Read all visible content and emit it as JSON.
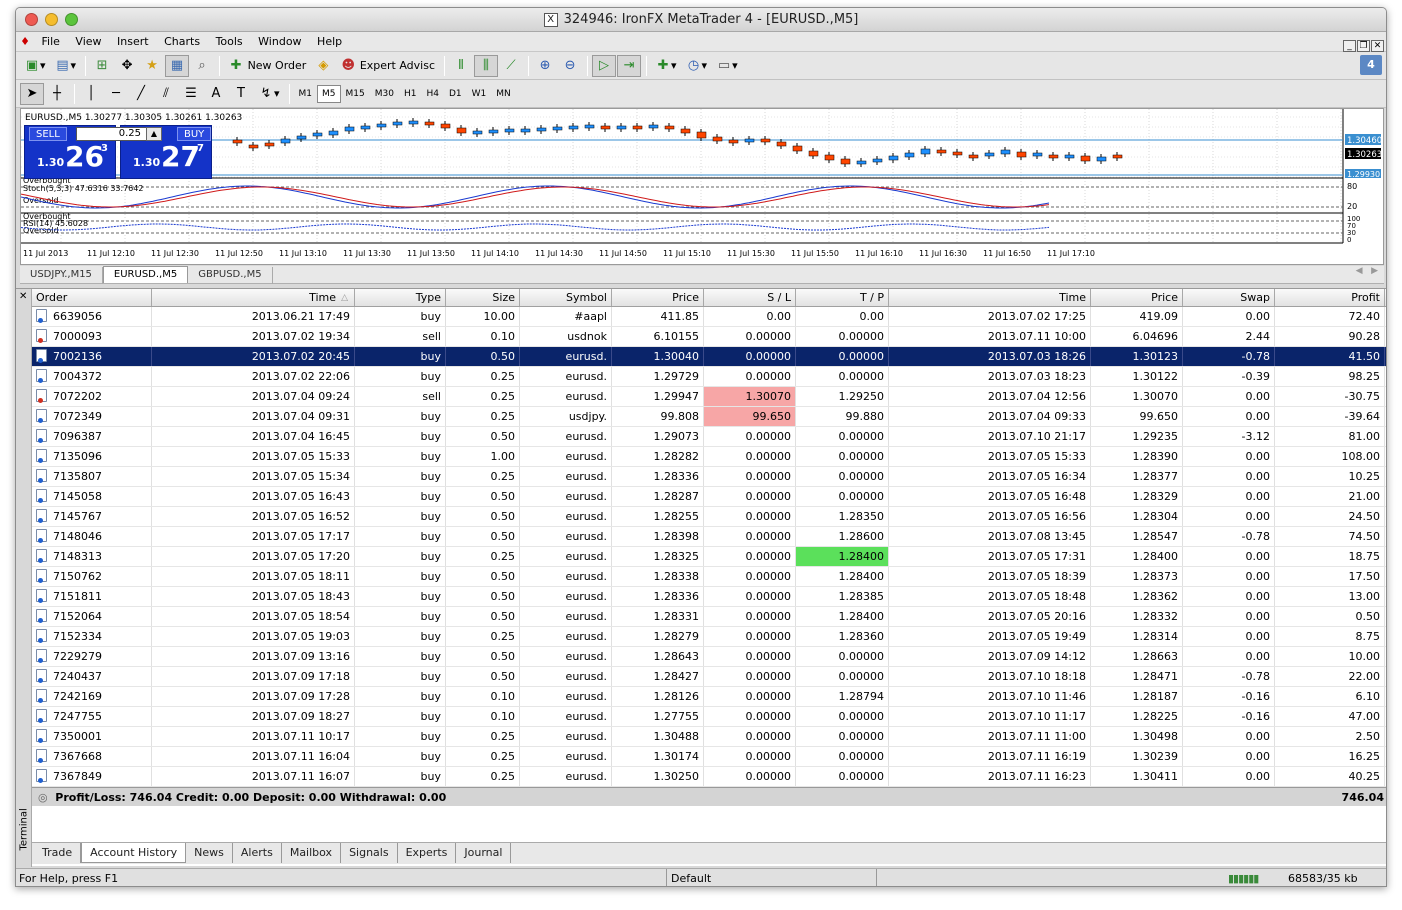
{
  "window": {
    "title": "324946: IronFX MetaTrader 4 - [EURUSD.,M5]"
  },
  "menu": [
    "File",
    "View",
    "Insert",
    "Charts",
    "Tools",
    "Window",
    "Help"
  ],
  "toolbar1": {
    "new_order": "New Order",
    "expert_advisors": "Expert Advisc",
    "badge": "4"
  },
  "timeframes": [
    "M1",
    "M5",
    "M15",
    "M30",
    "H1",
    "H4",
    "D1",
    "W1",
    "MN"
  ],
  "active_timeframe": "M5",
  "chart": {
    "header": "EURUSD.,M5  1.30277 1.30305 1.30261 1.30263",
    "one_click": {
      "sell_label": "SELL",
      "buy_label": "BUY",
      "volume": "0.25",
      "sell_small": "1.30",
      "sell_big": "26",
      "sell_sup": "3",
      "buy_small": "1.30",
      "buy_big": "27",
      "buy_sup": "7"
    },
    "price_labels": [
      "1.30460",
      "1.30263",
      "1.29930"
    ],
    "stoch": {
      "label": "Stoch(5,3,3) 47.6316 33.7642",
      "overbought": "Overbought",
      "oversold": "Oversold",
      "levels": [
        "80",
        "20"
      ]
    },
    "rsi": {
      "label": "RSI(14) 45.6028",
      "overbought": "Overbought",
      "oversold": "Oversold",
      "levels": [
        "100",
        "70",
        "30",
        "0"
      ]
    },
    "time_labels": [
      "11 Jul 2013",
      "11 Jul 12:10",
      "11 Jul 12:30",
      "11 Jul 12:50",
      "11 Jul 13:10",
      "11 Jul 13:30",
      "11 Jul 13:50",
      "11 Jul 14:10",
      "11 Jul 14:30",
      "11 Jul 14:50",
      "11 Jul 15:10",
      "11 Jul 15:30",
      "11 Jul 15:50",
      "11 Jul 16:10",
      "11 Jul 16:30",
      "11 Jul 16:50",
      "11 Jul 17:10"
    ]
  },
  "chart_tabs": [
    "USDJPY.,M15",
    "EURUSD.,M5",
    "GBPUSD.,M5"
  ],
  "active_chart_tab": "EURUSD.,M5",
  "colors": {
    "bull": "#1e90ff",
    "bear": "#ff4500",
    "selection": "#0a246a",
    "sl_hit": "#f7a6a6",
    "tp_hit": "#5be05b"
  },
  "table": {
    "columns": [
      "Order",
      "Time",
      "Type",
      "Size",
      "Symbol",
      "Price",
      "S / L",
      "T / P",
      "Time",
      "Price",
      "Swap",
      "Profit"
    ],
    "rows": [
      [
        "6639056",
        "2013.06.21 17:49",
        "buy",
        "10.00",
        "#aapl",
        "411.85",
        "0.00",
        "0.00",
        "2013.07.02 17:25",
        "419.09",
        "0.00",
        "72.40"
      ],
      [
        "7000093",
        "2013.07.02 19:34",
        "sell",
        "0.10",
        "usdnok",
        "6.10155",
        "0.00000",
        "0.00000",
        "2013.07.11 10:00",
        "6.04696",
        "2.44",
        "90.28"
      ],
      [
        "7002136",
        "2013.07.02 20:45",
        "buy",
        "0.50",
        "eurusd.",
        "1.30040",
        "0.00000",
        "0.00000",
        "2013.07.03 18:26",
        "1.30123",
        "-0.78",
        "41.50"
      ],
      [
        "7004372",
        "2013.07.02 22:06",
        "buy",
        "0.25",
        "eurusd.",
        "1.29729",
        "0.00000",
        "0.00000",
        "2013.07.03 18:23",
        "1.30122",
        "-0.39",
        "98.25"
      ],
      [
        "7072202",
        "2013.07.04 09:24",
        "sell",
        "0.25",
        "eurusd.",
        "1.29947",
        "1.30070",
        "1.29250",
        "2013.07.04 12:56",
        "1.30070",
        "0.00",
        "-30.75"
      ],
      [
        "7072349",
        "2013.07.04 09:31",
        "buy",
        "0.25",
        "usdjpy.",
        "99.808",
        "99.650",
        "99.880",
        "2013.07.04 09:33",
        "99.650",
        "0.00",
        "-39.64"
      ],
      [
        "7096387",
        "2013.07.04 16:45",
        "buy",
        "0.50",
        "eurusd.",
        "1.29073",
        "0.00000",
        "0.00000",
        "2013.07.10 21:17",
        "1.29235",
        "-3.12",
        "81.00"
      ],
      [
        "7135096",
        "2013.07.05 15:33",
        "buy",
        "1.00",
        "eurusd.",
        "1.28282",
        "0.00000",
        "0.00000",
        "2013.07.05 15:33",
        "1.28390",
        "0.00",
        "108.00"
      ],
      [
        "7135807",
        "2013.07.05 15:34",
        "buy",
        "0.25",
        "eurusd.",
        "1.28336",
        "0.00000",
        "0.00000",
        "2013.07.05 16:34",
        "1.28377",
        "0.00",
        "10.25"
      ],
      [
        "7145058",
        "2013.07.05 16:43",
        "buy",
        "0.50",
        "eurusd.",
        "1.28287",
        "0.00000",
        "0.00000",
        "2013.07.05 16:48",
        "1.28329",
        "0.00",
        "21.00"
      ],
      [
        "7145767",
        "2013.07.05 16:52",
        "buy",
        "0.50",
        "eurusd.",
        "1.28255",
        "0.00000",
        "1.28350",
        "2013.07.05 16:56",
        "1.28304",
        "0.00",
        "24.50"
      ],
      [
        "7148046",
        "2013.07.05 17:17",
        "buy",
        "0.50",
        "eurusd.",
        "1.28398",
        "0.00000",
        "1.28600",
        "2013.07.08 13:45",
        "1.28547",
        "-0.78",
        "74.50"
      ],
      [
        "7148313",
        "2013.07.05 17:20",
        "buy",
        "0.25",
        "eurusd.",
        "1.28325",
        "0.00000",
        "1.28400",
        "2013.07.05 17:31",
        "1.28400",
        "0.00",
        "18.75"
      ],
      [
        "7150762",
        "2013.07.05 18:11",
        "buy",
        "0.50",
        "eurusd.",
        "1.28338",
        "0.00000",
        "1.28400",
        "2013.07.05 18:39",
        "1.28373",
        "0.00",
        "17.50"
      ],
      [
        "7151811",
        "2013.07.05 18:43",
        "buy",
        "0.50",
        "eurusd.",
        "1.28336",
        "0.00000",
        "1.28385",
        "2013.07.05 18:48",
        "1.28362",
        "0.00",
        "13.00"
      ],
      [
        "7152064",
        "2013.07.05 18:54",
        "buy",
        "0.50",
        "eurusd.",
        "1.28331",
        "0.00000",
        "1.28400",
        "2013.07.05 20:16",
        "1.28332",
        "0.00",
        "0.50"
      ],
      [
        "7152334",
        "2013.07.05 19:03",
        "buy",
        "0.25",
        "eurusd.",
        "1.28279",
        "0.00000",
        "1.28360",
        "2013.07.05 19:49",
        "1.28314",
        "0.00",
        "8.75"
      ],
      [
        "7229279",
        "2013.07.09 13:16",
        "buy",
        "0.50",
        "eurusd.",
        "1.28643",
        "0.00000",
        "0.00000",
        "2013.07.09 14:12",
        "1.28663",
        "0.00",
        "10.00"
      ],
      [
        "7240437",
        "2013.07.09 17:18",
        "buy",
        "0.50",
        "eurusd.",
        "1.28427",
        "0.00000",
        "0.00000",
        "2013.07.10 18:18",
        "1.28471",
        "-0.78",
        "22.00"
      ],
      [
        "7242169",
        "2013.07.09 17:28",
        "buy",
        "0.10",
        "eurusd.",
        "1.28126",
        "0.00000",
        "1.28794",
        "2013.07.10 11:46",
        "1.28187",
        "-0.16",
        "6.10"
      ],
      [
        "7247755",
        "2013.07.09 18:27",
        "buy",
        "0.10",
        "eurusd.",
        "1.27755",
        "0.00000",
        "0.00000",
        "2013.07.10 11:17",
        "1.28225",
        "-0.16",
        "47.00"
      ],
      [
        "7350001",
        "2013.07.11 10:17",
        "buy",
        "0.25",
        "eurusd.",
        "1.30488",
        "0.00000",
        "0.00000",
        "2013.07.11 11:00",
        "1.30498",
        "0.00",
        "2.50"
      ],
      [
        "7367668",
        "2013.07.11 16:04",
        "buy",
        "0.25",
        "eurusd.",
        "1.30174",
        "0.00000",
        "0.00000",
        "2013.07.11 16:19",
        "1.30239",
        "0.00",
        "16.25"
      ],
      [
        "7367849",
        "2013.07.11 16:07",
        "buy",
        "0.25",
        "eurusd.",
        "1.30250",
        "0.00000",
        "0.00000",
        "2013.07.11 16:23",
        "1.30411",
        "0.00",
        "40.25"
      ]
    ],
    "selected_row": 2,
    "highlights": [
      {
        "row": 4,
        "col": 6,
        "kind": "sl"
      },
      {
        "row": 5,
        "col": 6,
        "kind": "sl"
      },
      {
        "row": 12,
        "col": 7,
        "kind": "tp"
      }
    ],
    "summary": "Profit/Loss: 746.04  Credit: 0.00  Deposit: 0.00  Withdrawal: 0.00",
    "summary_total": "746.04"
  },
  "terminal_label": "Terminal",
  "bottom_tabs": [
    "Trade",
    "Account History",
    "News",
    "Alerts",
    "Mailbox",
    "Signals",
    "Experts",
    "Journal"
  ],
  "active_bottom_tab": "Account History",
  "status": {
    "help": "For Help, press F1",
    "profile": "Default",
    "traffic": "68583/35 kb"
  }
}
